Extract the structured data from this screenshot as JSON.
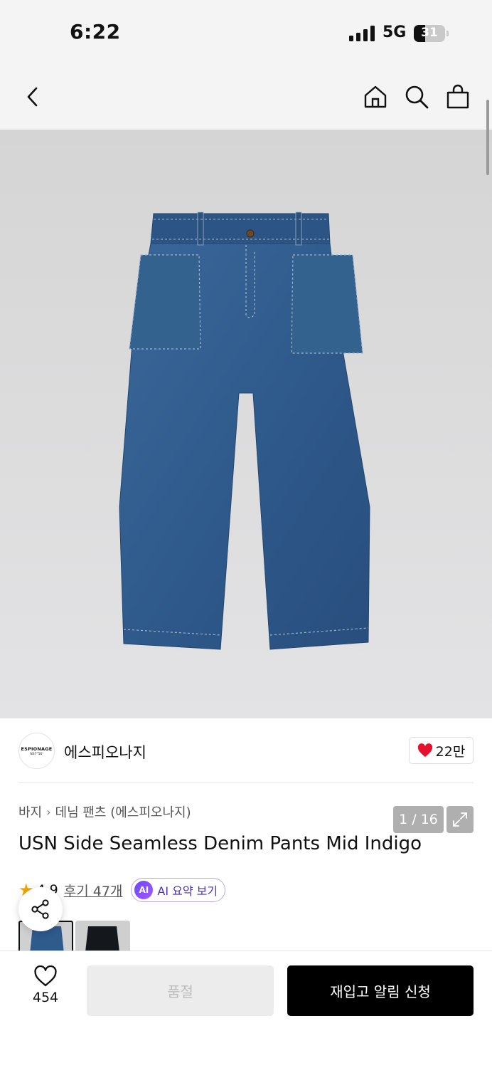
{
  "status": {
    "time": "6:22",
    "network": "5G",
    "battery": "31"
  },
  "nav": {
    "back_icon": "chevron-left-icon",
    "home_icon": "home-icon",
    "search_icon": "search-icon",
    "cart_icon": "shopping-bag-icon"
  },
  "gallery": {
    "counter": "1 / 16",
    "expand_icon": "expand-icon"
  },
  "brand": {
    "logo_line1": "ESPIONAGE",
    "logo_line2": "N37°56'",
    "name": "에스피오나지",
    "likes": "22만",
    "heart_color": "#e8112d"
  },
  "breadcrumb": {
    "category": "바지",
    "subcategory": "데님 팬츠 (에스피오나지)"
  },
  "product": {
    "title": "USN Side Seamless Denim Pants Mid Indigo",
    "rating": "4.9",
    "reviews": "후기 47개",
    "ai_badge": "AI",
    "ai_summary": "AI 요약 보기"
  },
  "bottom": {
    "wish_count": "454",
    "soldout_label": "품절",
    "restock_label": "재입고 알림 신청"
  },
  "colors": {
    "accent_black": "#000000",
    "star": "#f8a300",
    "denim": "#2f5a8c"
  }
}
